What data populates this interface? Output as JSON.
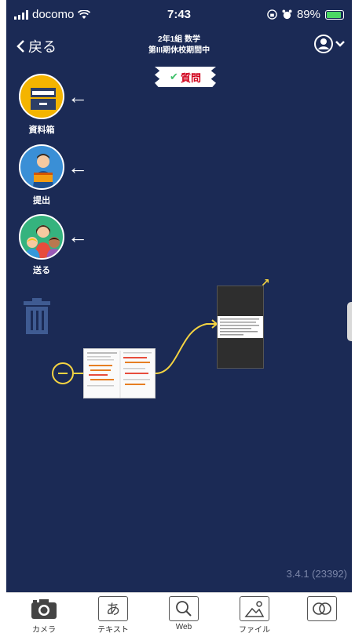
{
  "status_bar": {
    "carrier": "docomo",
    "time": "7:43",
    "battery_percent": "89%",
    "battery_level": 0.89
  },
  "header": {
    "back_label": "戻る",
    "title_line1": "2年1組 数学",
    "title_line2": "第III期休校期間中",
    "question_tag": "質問"
  },
  "side_menu": [
    {
      "label": "資料箱",
      "icon": "filing-cabinet-icon"
    },
    {
      "label": "提出",
      "icon": "submit-person-icon"
    },
    {
      "label": "送る",
      "icon": "send-group-icon"
    }
  ],
  "version": "3.4.1 (23392)",
  "toolbar": {
    "items": [
      {
        "label": "カメラ",
        "icon": "camera-icon"
      },
      {
        "label": "テキスト",
        "icon": "text-icon",
        "glyph": "あ"
      },
      {
        "label": "Web",
        "icon": "web-search-icon"
      },
      {
        "label": "ファイル",
        "icon": "file-image-icon"
      },
      {
        "label": "",
        "icon": "integration-icon"
      }
    ]
  },
  "colors": {
    "background": "#1b2a55",
    "accent_yellow": "#f5d442",
    "tag_red": "#d0021b",
    "battery_green": "#4cd964"
  }
}
